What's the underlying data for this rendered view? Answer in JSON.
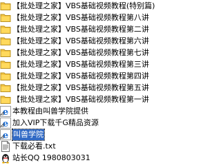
{
  "files": [
    {
      "name": "【批处理之家】VBS基础视频教程(特别篇)",
      "icon": "folder-icon"
    },
    {
      "name": "【批处理之家】VBS基础视频教程第八讲",
      "icon": "folder-icon"
    },
    {
      "name": "【批处理之家】VBS基础视频教程第二讲",
      "icon": "folder-icon"
    },
    {
      "name": "【批处理之家】VBS基础视频教程第六讲",
      "icon": "folder-icon"
    },
    {
      "name": "【批处理之家】VBS基础视频教程第七讲",
      "icon": "folder-icon"
    },
    {
      "name": "【批处理之家】VBS基础视频教程第三讲",
      "icon": "folder-icon"
    },
    {
      "name": "【批处理之家】VBS基础视频教程第四讲",
      "icon": "folder-icon"
    },
    {
      "name": "【批处理之家】VBS基础视频教程第五讲",
      "icon": "folder-icon"
    },
    {
      "name": "【批处理之家】VBS基础视频教程第一讲",
      "icon": "folder-icon"
    },
    {
      "name": "本教程由叫兽学院提供",
      "icon": "ie-shortcut-icon"
    },
    {
      "name": "加入VIP下载千G精品资源",
      "icon": "ie-shortcut-icon"
    },
    {
      "name": "叫兽学院",
      "icon": "ie-shortcut-icon",
      "selected": true
    },
    {
      "name": "下载必看.txt",
      "icon": "text-file-icon"
    },
    {
      "name": "站长QQ 1980803031",
      "icon": "qq-icon"
    }
  ],
  "colors": {
    "folder": "#f3c443",
    "selection": "#316ac5",
    "ie_blue": "#1e6fd6"
  }
}
